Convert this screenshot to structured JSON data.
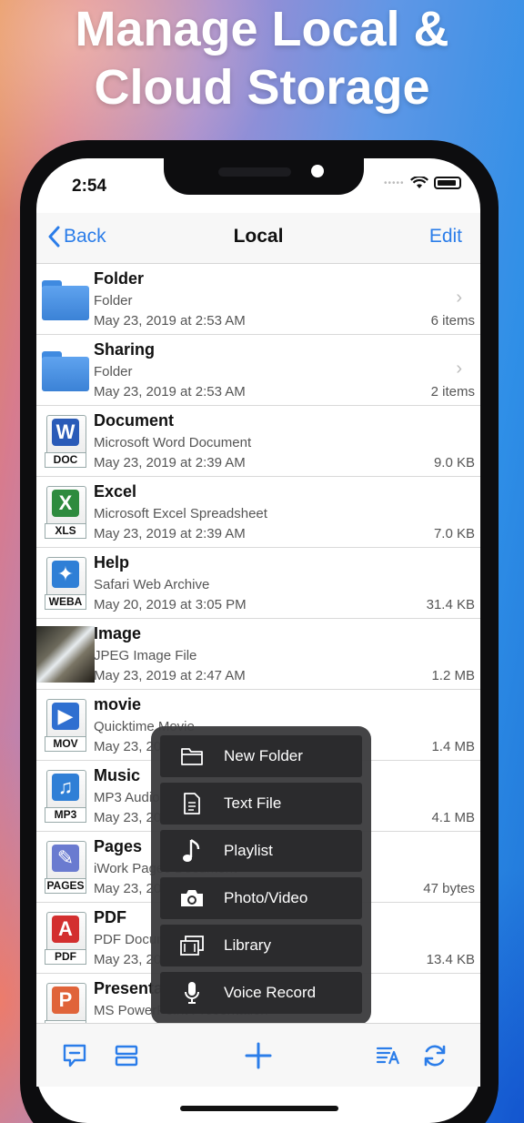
{
  "headline": {
    "line1": "Manage Local &",
    "line2": "Cloud Storage"
  },
  "status_bar": {
    "time": "2:54",
    "dots": "•••••"
  },
  "nav": {
    "back_label": "Back",
    "title": "Local",
    "edit_label": "Edit"
  },
  "files": [
    {
      "name": "Folder",
      "type": "Folder",
      "date": "May 23, 2019 at 2:53 AM",
      "size": "6 items",
      "icon": "folder-icon",
      "chevron": "›"
    },
    {
      "name": "Sharing",
      "type": "Folder",
      "date": "May 23, 2019 at 2:53 AM",
      "size": "2 items",
      "icon": "folder-icon",
      "chevron": "›"
    },
    {
      "name": "Document",
      "type": "Microsoft Word Document",
      "date": "May 23, 2019 at 2:39 AM",
      "size": "9.0 KB",
      "icon": "word-doc-icon",
      "badge": "DOC",
      "glyph": "W",
      "color": "#2a5bb8"
    },
    {
      "name": "Excel",
      "type": "Microsoft Excel Spreadsheet",
      "date": "May 23, 2019 at 2:39 AM",
      "size": "7.0 KB",
      "icon": "excel-xls-icon",
      "badge": "XLS",
      "glyph": "X",
      "color": "#2e8b3e"
    },
    {
      "name": "Help",
      "type": "Safari Web Archive",
      "date": "May 20, 2019 at 3:05 PM",
      "size": "31.4 KB",
      "icon": "safari-weba-icon",
      "badge": "WEBA",
      "glyph": "✦",
      "color": "#2f7fd6"
    },
    {
      "name": "Image",
      "type": "JPEG Image File",
      "date": "May 23, 2019 at 2:47 AM",
      "size": "1.2 MB",
      "icon": "image-thumbnail"
    },
    {
      "name": "movie",
      "type": "Quicktime Movie",
      "date": "May 23, 2019 at 2:49 AM",
      "size": "1.4 MB",
      "icon": "movie-mov-icon",
      "badge": "MOV",
      "glyph": "▶",
      "color": "#2f6fd0"
    },
    {
      "name": "Music",
      "type": "MP3 Audio File",
      "date": "May 23, 2019 at 2:49 AM",
      "size": "4.1 MB",
      "icon": "music-mp3-icon",
      "badge": "MP3",
      "glyph": "♫",
      "color": "#2f7fd6"
    },
    {
      "name": "Pages",
      "type": "iWork Pages Document",
      "date": "May 23, 2019 at 2:49 AM",
      "size": "47 bytes",
      "icon": "pages-icon",
      "badge": "PAGES",
      "glyph": "✎",
      "color": "#6a7bd0"
    },
    {
      "name": "PDF",
      "type": "PDF Document",
      "date": "May 23, 2019 at 2:49 AM",
      "size": "13.4 KB",
      "icon": "pdf-icon",
      "badge": "PDF",
      "glyph": "A",
      "color": "#d32f2f"
    },
    {
      "name": "Presentation",
      "type": "MS PowerPoint Presentation",
      "date": "",
      "size": "",
      "icon": "powerpoint-icon",
      "badge": "PPT",
      "glyph": "P",
      "color": "#e0643a"
    }
  ],
  "popup_menu": [
    {
      "label": "New Folder",
      "icon": "folder-outline-icon"
    },
    {
      "label": "Text File",
      "icon": "text-file-icon"
    },
    {
      "label": "Playlist",
      "icon": "music-note-icon"
    },
    {
      "label": "Photo/Video",
      "icon": "camera-icon"
    },
    {
      "label": "Library",
      "icon": "library-icon"
    },
    {
      "label": "Voice Record",
      "icon": "microphone-icon"
    }
  ],
  "toolbar": {
    "items": [
      "comment-icon",
      "list-view-icon",
      "add-icon",
      "sort-icon",
      "sync-icon"
    ]
  },
  "colors": {
    "accent": "#2b7de9"
  }
}
